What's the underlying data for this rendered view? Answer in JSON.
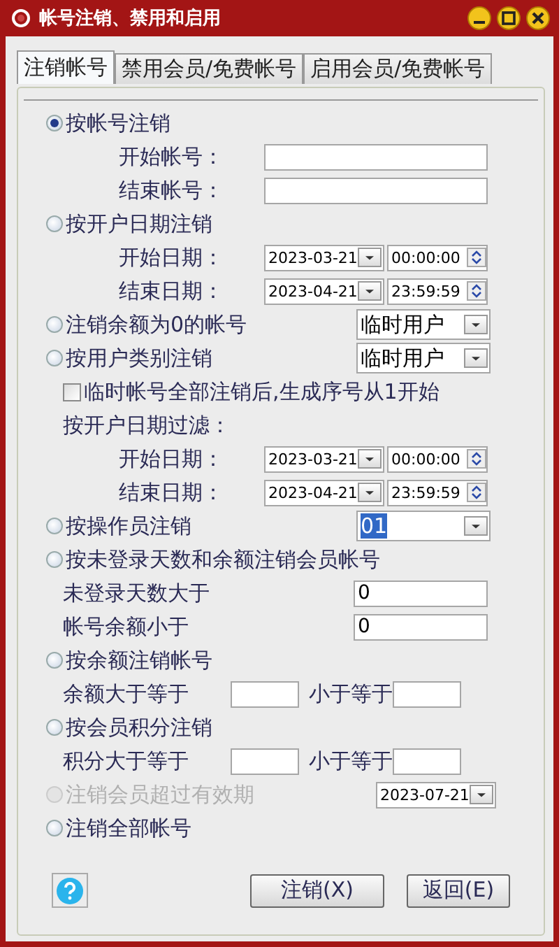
{
  "window": {
    "title": "帐号注销、禁用和启用"
  },
  "tabs": [
    {
      "label": "注销帐号",
      "selected": true
    },
    {
      "label": "禁用会员/免费帐号",
      "selected": false
    },
    {
      "label": "启用会员/免费帐号",
      "selected": false
    }
  ],
  "rows": [
    {
      "kind": "radio",
      "label": "按帐号注销",
      "selected": true,
      "disabled": false
    },
    {
      "kind": "account_field",
      "label": "开始帐号："
    },
    {
      "kind": "account_field",
      "label": "结束帐号："
    },
    {
      "kind": "radio",
      "label": "按开户日期注销",
      "selected": false,
      "disabled": false
    },
    {
      "kind": "datetime",
      "label": "开始日期：",
      "date": "2023-03-21",
      "time": "00:00:00"
    },
    {
      "kind": "datetime",
      "label": "结束日期：",
      "date": "2023-04-21",
      "time": "23:59:59"
    },
    {
      "kind": "radio",
      "label": "注销余额为0的帐号",
      "selected": false,
      "disabled": false,
      "combo": {
        "value": "临时用户",
        "highlighted": false
      }
    },
    {
      "kind": "radio",
      "label": "按用户类别注销",
      "selected": false,
      "disabled": false,
      "combo": {
        "value": "临时用户",
        "highlighted": false
      }
    },
    {
      "kind": "checkbox",
      "label": "临时帐号全部注销后,生成序号从1开始",
      "checked": false
    },
    {
      "kind": "text",
      "label": "按开户日期过滤："
    },
    {
      "kind": "datetime",
      "label": "开始日期：",
      "date": "2023-03-21",
      "time": "00:00:00"
    },
    {
      "kind": "datetime",
      "label": "结束日期：",
      "date": "2023-04-21",
      "time": "23:59:59"
    },
    {
      "kind": "radio",
      "label": "按操作员注销",
      "selected": false,
      "disabled": false,
      "combo": {
        "value": "01",
        "highlighted": true
      }
    },
    {
      "kind": "radio",
      "label": "按未登录天数和余额注销会员帐号",
      "selected": false,
      "disabled": false
    },
    {
      "kind": "value_field",
      "label": "未登录天数大于",
      "value": "0"
    },
    {
      "kind": "value_field",
      "label": "帐号余额小于",
      "value": "0"
    },
    {
      "kind": "radio",
      "label": "按余额注销帐号",
      "selected": false,
      "disabled": false
    },
    {
      "kind": "range",
      "label": "余额大于等于",
      "second_label": "小于等于"
    },
    {
      "kind": "radio",
      "label": "按会员积分注销",
      "selected": false,
      "disabled": false
    },
    {
      "kind": "range",
      "label": "积分大于等于",
      "second_label": "小于等于"
    },
    {
      "kind": "radio",
      "label": "注销会员超过有效期",
      "selected": false,
      "disabled": true,
      "date": "2023-07-21"
    },
    {
      "kind": "radio",
      "label": "注销全部帐号",
      "selected": false,
      "disabled": false
    }
  ],
  "buttons": [
    {
      "label": "注销(X)"
    },
    {
      "label": "返回(E)"
    }
  ]
}
